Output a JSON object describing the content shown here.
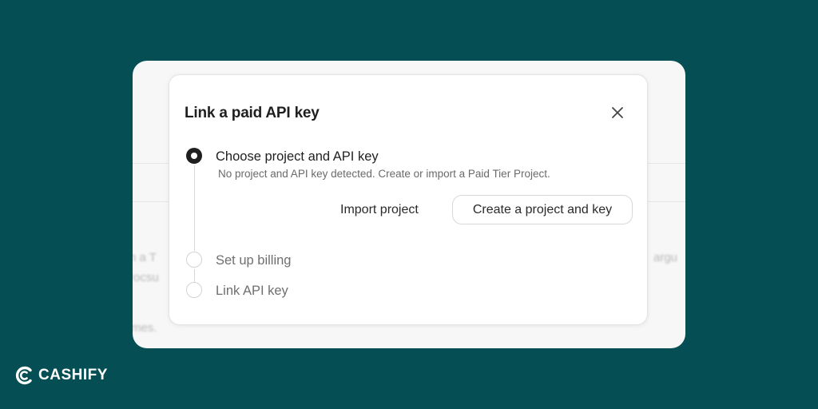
{
  "background": {
    "color": "#054e53",
    "card_color": "#f7f7f7"
  },
  "blurred_page": {
    "fragment_left_1": "n a T",
    "fragment_left_2": "rocsu",
    "fragment_left_3": "mes.",
    "fragment_right_1": "argu"
  },
  "dialog": {
    "title": "Link a paid API key",
    "close_icon": "close-icon",
    "steps": [
      {
        "label": "Choose project and API key",
        "state": "active",
        "description": "No project and API key detected. Create or import a Paid Tier Project."
      },
      {
        "label": "Set up billing",
        "state": "inactive"
      },
      {
        "label": "Link API key",
        "state": "inactive"
      }
    ],
    "import_button": "Import project",
    "create_button": "Create a project and key"
  },
  "watermark": {
    "brand": "CASHIFY",
    "logo_icon": "cashify-logo-icon",
    "color": "#ffffff"
  }
}
